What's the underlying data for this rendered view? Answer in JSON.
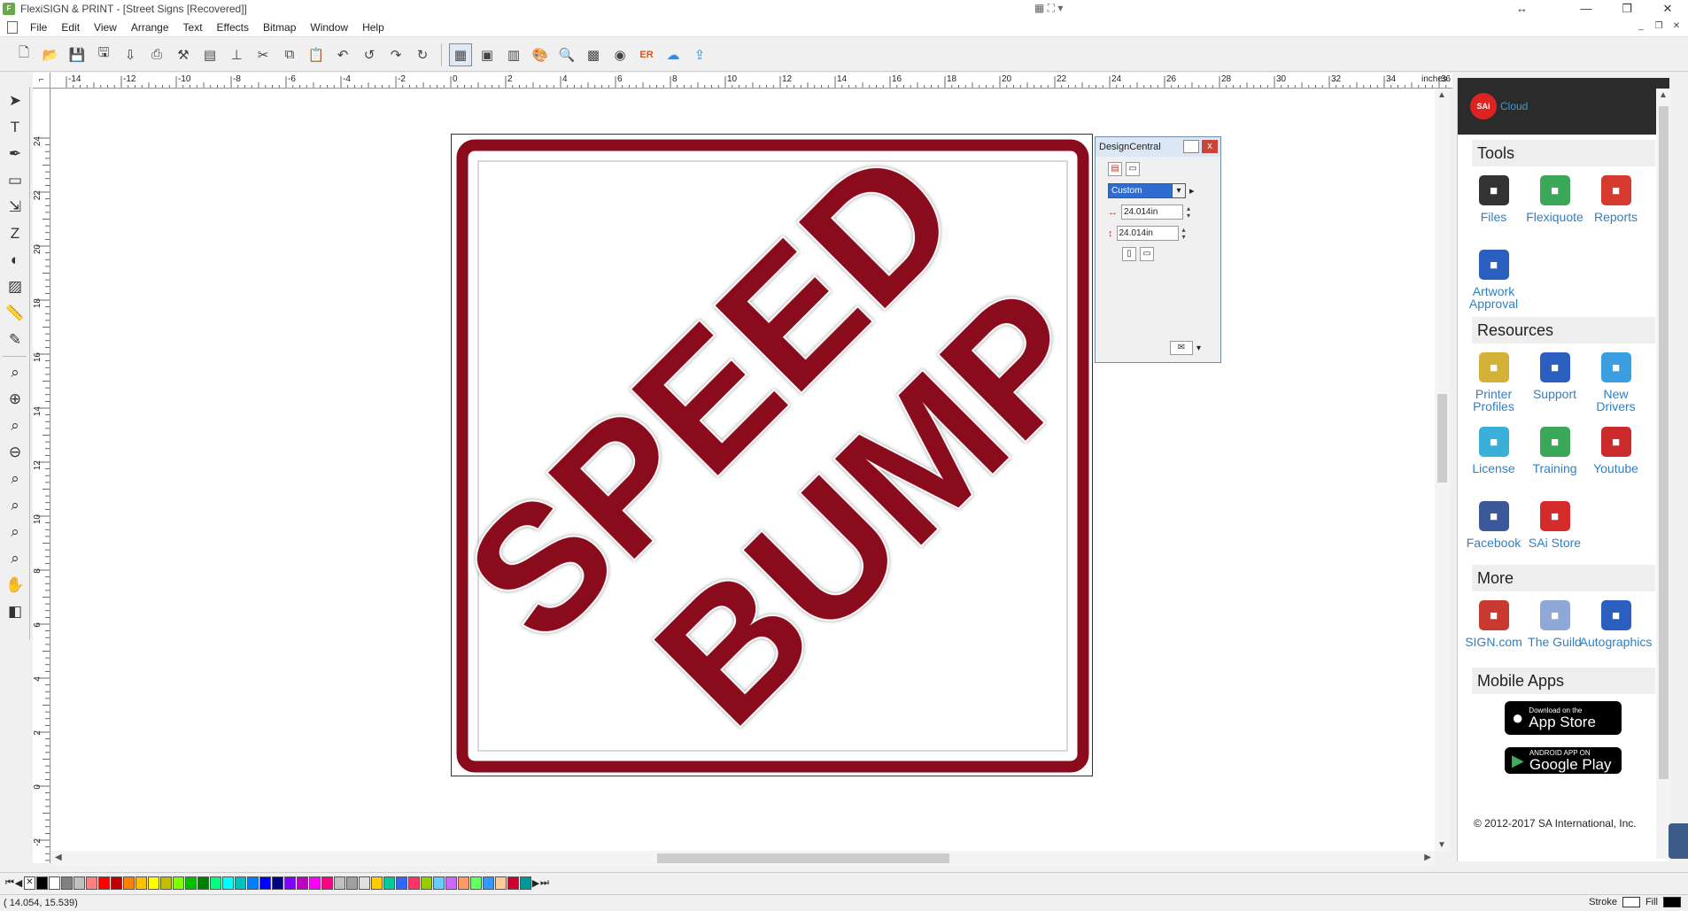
{
  "window": {
    "title": "FlexiSIGN & PRINT - [Street Signs [Recovered]]",
    "minimize": "—",
    "restore": "❐",
    "close": "✕"
  },
  "menu": [
    "File",
    "Edit",
    "View",
    "Arrange",
    "Text",
    "Effects",
    "Bitmap",
    "Window",
    "Help"
  ],
  "ruler": {
    "unit": "inches",
    "h_ticks": [
      "-14",
      "-12",
      "-10",
      "-8",
      "-6",
      "-4",
      "-2",
      "0",
      "2",
      "4",
      "6",
      "8",
      "10",
      "12",
      "14",
      "16",
      "18",
      "20",
      "22",
      "24",
      "26",
      "28",
      "30",
      "32",
      "34",
      "36"
    ],
    "v_ticks": [
      "24",
      "22",
      "20",
      "18",
      "16",
      "14",
      "12",
      "10",
      "8",
      "6",
      "4",
      "2",
      "0",
      "-2"
    ]
  },
  "sign": {
    "line1": "SPEED",
    "line2": "BUMP",
    "color": "#8a0b1c"
  },
  "design_central": {
    "title": "DesignCentral",
    "preset": "Custom",
    "width": "24.014in",
    "height": "24.014in"
  },
  "right_panel": {
    "header": "Cloud",
    "logo": "SAi",
    "sections": {
      "tools": "Tools",
      "resources": "Resources",
      "more": "More",
      "mobile": "Mobile Apps"
    },
    "tools": [
      {
        "label": "Files",
        "icon": "files-icon",
        "color": "#333333"
      },
      {
        "label": "Flexiquote",
        "icon": "flexiquote-icon",
        "color": "#3aa858"
      },
      {
        "label": "Reports",
        "icon": "reports-icon",
        "color": "#d63a2f"
      },
      {
        "label": "Artwork Approval",
        "icon": "artwork-approval-icon",
        "color": "#2a5fbf"
      }
    ],
    "resources": [
      {
        "label": "Printer Profiles",
        "icon": "printer-profiles-icon",
        "color": "#d4b23a"
      },
      {
        "label": "Support",
        "icon": "support-icon",
        "color": "#2a5fbf"
      },
      {
        "label": "New Drivers",
        "icon": "new-drivers-icon",
        "color": "#3a9ee0"
      },
      {
        "label": "License",
        "icon": "license-icon",
        "color": "#3ab0d8"
      },
      {
        "label": "Training",
        "icon": "training-icon",
        "color": "#3aa858"
      },
      {
        "label": "Youtube",
        "icon": "youtube-icon",
        "color": "#cc2b2b"
      },
      {
        "label": "Facebook",
        "icon": "facebook-icon",
        "color": "#3b5998"
      },
      {
        "label": "SAi Store",
        "icon": "sai-store-icon",
        "color": "#d62b2b"
      }
    ],
    "more": [
      {
        "label": "SIGN.com",
        "icon": "sign-com-icon",
        "color": "#c83a2f"
      },
      {
        "label": "The Guild",
        "icon": "the-guild-icon",
        "color": "#8fa8d8"
      },
      {
        "label": "Autographics",
        "icon": "autographics-icon",
        "color": "#2a5fbf"
      }
    ],
    "app_store": {
      "small": "Download on the",
      "big": "App Store"
    },
    "google_play": {
      "small": "ANDROID APP ON",
      "big": "Google Play"
    },
    "copyright": "© 2012-2017 SA International, Inc."
  },
  "palette": [
    "#000000",
    "#ffffff",
    "#808080",
    "#c0c0c0",
    "#ff8080",
    "#ff0000",
    "#c00000",
    "#ff8000",
    "#ffc000",
    "#ffff00",
    "#c0c000",
    "#80ff00",
    "#00c000",
    "#008000",
    "#00ff80",
    "#00ffff",
    "#00c0c0",
    "#0080ff",
    "#0000ff",
    "#000080",
    "#8000ff",
    "#c000c0",
    "#ff00ff",
    "#ff0080",
    "#c0c0c0",
    "#a0a0a0",
    "#e0e0e0",
    "#ffcc00",
    "#00cc99",
    "#3366ff",
    "#ff3366",
    "#99cc00",
    "#66ccff",
    "#cc66ff",
    "#ff9966",
    "#66ff66",
    "#3399ff",
    "#ffcc99",
    "#cc0033",
    "#009999"
  ],
  "status": {
    "coords": "( 14.054,   15.539)",
    "stroke": "Stroke",
    "fill": "Fill"
  }
}
